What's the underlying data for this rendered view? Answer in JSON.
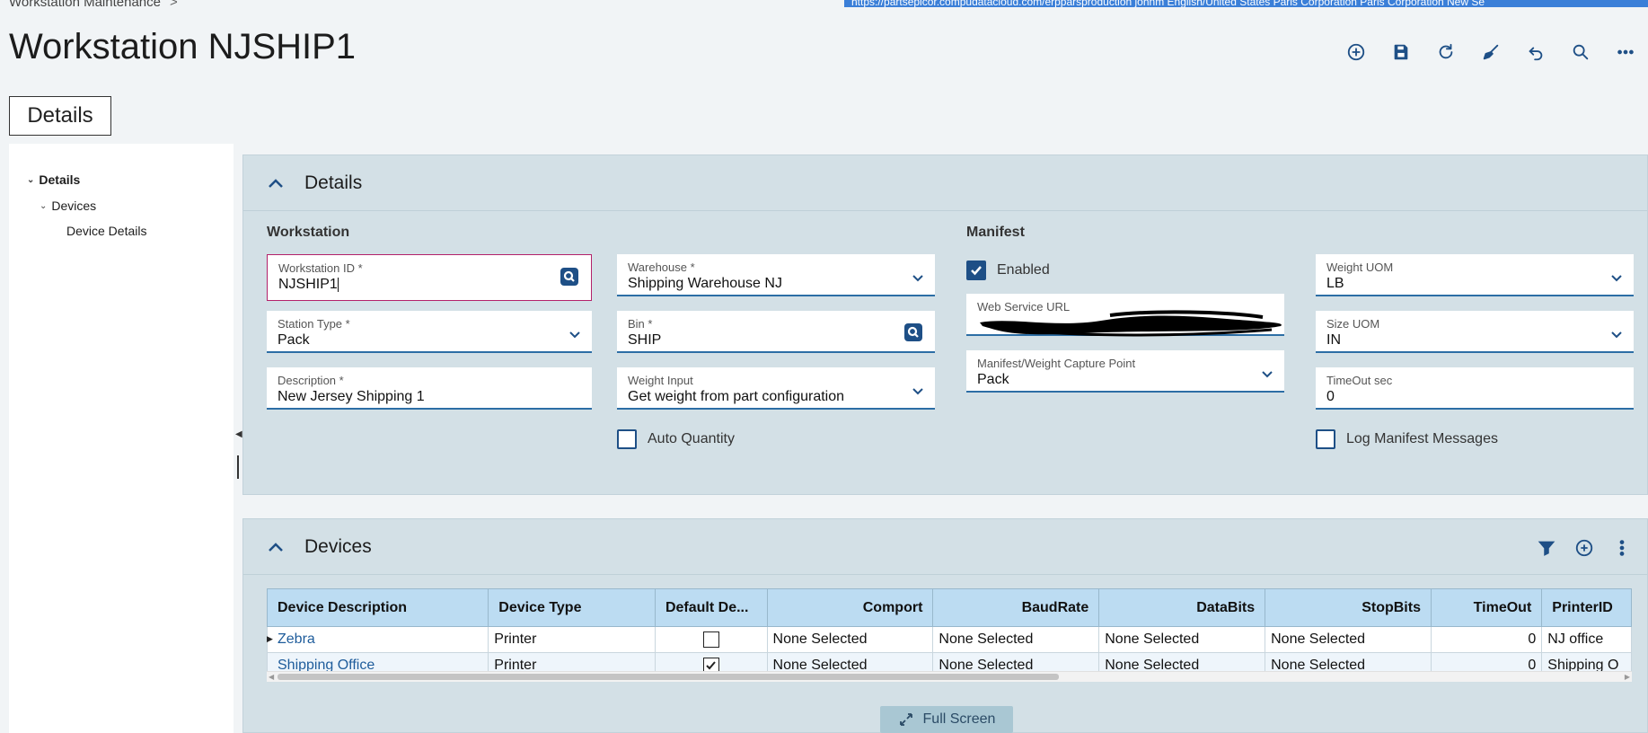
{
  "breadcrumb": {
    "label": "Workstation Maintenance",
    "separator": ">"
  },
  "url_bar": "https://partsepicor.compudatacloud.com/erpparsproduction   johnm   English/United States   Paris Corporation   Paris Corporation New Se",
  "page_title": "Workstation NJSHIP1",
  "toolbar": {
    "icons": [
      "add-icon",
      "save-icon",
      "refresh-icon",
      "clear-icon",
      "undo-icon",
      "search-icon",
      "more-icon"
    ]
  },
  "tab": {
    "label": "Details"
  },
  "tree": {
    "items": [
      {
        "label": "Details"
      },
      {
        "label": "Devices"
      },
      {
        "label": "Device Details"
      }
    ]
  },
  "details_panel": {
    "title": "Details",
    "workstation_group": "Workstation",
    "manifest_group": "Manifest",
    "workstation_id": {
      "label": "Workstation ID *",
      "value": "NJSHIP1"
    },
    "station_type": {
      "label": "Station Type *",
      "value": "Pack"
    },
    "description": {
      "label": "Description *",
      "value": "New Jersey Shipping 1"
    },
    "warehouse": {
      "label": "Warehouse *",
      "value": "Shipping Warehouse NJ"
    },
    "bin": {
      "label": "Bin *",
      "value": "SHIP"
    },
    "weight_input": {
      "label": "Weight Input",
      "value": "Get weight from part configuration"
    },
    "auto_quantity": {
      "label": "Auto Quantity",
      "checked": false
    },
    "enabled": {
      "label": "Enabled",
      "checked": true
    },
    "web_service_url": {
      "label": "Web Service URL",
      "value": ""
    },
    "capture_point": {
      "label": "Manifest/Weight Capture Point",
      "value": "Pack"
    },
    "weight_uom": {
      "label": "Weight UOM",
      "value": "LB"
    },
    "size_uom": {
      "label": "Size UOM",
      "value": "IN"
    },
    "timeout": {
      "label": "TimeOut sec",
      "value": "0"
    },
    "log_manifest": {
      "label": "Log Manifest Messages",
      "checked": false
    }
  },
  "devices_panel": {
    "title": "Devices",
    "columns": [
      "Device Description",
      "Device Type",
      "Default De...",
      "Comport",
      "BaudRate",
      "DataBits",
      "StopBits",
      "TimeOut",
      "PrinterID"
    ],
    "rows": [
      {
        "description": "Zebra",
        "type": "Printer",
        "default": false,
        "comport": "None Selected",
        "baud": "None Selected",
        "databits": "None Selected",
        "stopbits": "None Selected",
        "timeout": "0",
        "printer": "NJ office"
      },
      {
        "description": "Shipping Office",
        "type": "Printer",
        "default": true,
        "comport": "None Selected",
        "baud": "None Selected",
        "databits": "None Selected",
        "stopbits": "None Selected",
        "timeout": "0",
        "printer": "Shipping O"
      }
    ]
  },
  "fullscreen": {
    "label": "Full Screen"
  },
  "colors": {
    "accent": "#1e4f86",
    "panel": "#d3e0e6",
    "header_row": "#bcdcf2",
    "focus": "#b3216a"
  }
}
